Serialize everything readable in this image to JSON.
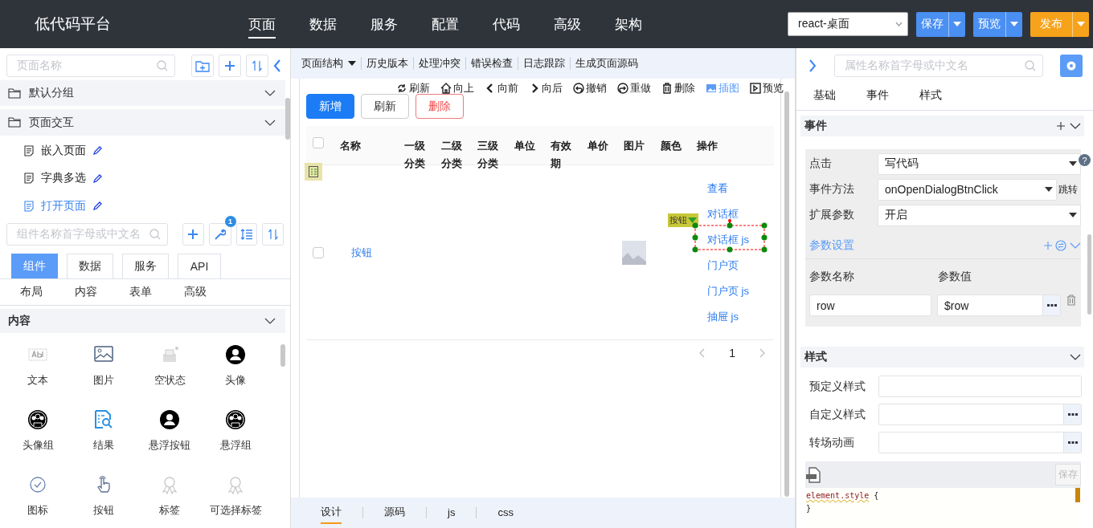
{
  "header": {
    "logo": "低代码平台",
    "nav": [
      {
        "label": "页面",
        "selected": true
      },
      {
        "label": "数据",
        "selected": false
      },
      {
        "label": "服务",
        "selected": false
      },
      {
        "label": "配置",
        "selected": false
      },
      {
        "label": "代码",
        "selected": false
      },
      {
        "label": "高级",
        "selected": false
      },
      {
        "label": "架构",
        "selected": false
      }
    ],
    "platform_select": "react-桌面",
    "actions": [
      {
        "label": "保存",
        "kind": "primary"
      },
      {
        "label": "预览",
        "kind": "primary"
      },
      {
        "label": "发布",
        "kind": "warning"
      }
    ]
  },
  "page_panel": {
    "search_placeholder": "页面名称",
    "groups": [
      {
        "label": "默认分组"
      },
      {
        "label": "页面交互",
        "children": [
          {
            "label": "嵌入页面",
            "selected": false
          },
          {
            "label": "字典多选",
            "selected": false
          },
          {
            "label": "打开页面",
            "selected": true
          }
        ]
      }
    ]
  },
  "component_panel": {
    "search_placeholder": "组件名称首字母或中文名",
    "badge": "1",
    "tabs": [
      {
        "label": "组件",
        "selected": true
      },
      {
        "label": "数据",
        "selected": false
      },
      {
        "label": "服务",
        "selected": false
      },
      {
        "label": "API",
        "selected": false
      }
    ],
    "categories": [
      "布局",
      "内容",
      "表单",
      "高级"
    ],
    "section": "内容",
    "components": [
      {
        "label": "文本",
        "kind": "text"
      },
      {
        "label": "图片",
        "kind": "image"
      },
      {
        "label": "空状态",
        "kind": "empty"
      },
      {
        "label": "头像",
        "kind": "avatar"
      },
      {
        "label": "头像组",
        "kind": "avatar-group"
      },
      {
        "label": "结果",
        "kind": "result"
      },
      {
        "label": "悬浮按钮",
        "kind": "avatar"
      },
      {
        "label": "悬浮组",
        "kind": "avatar-group"
      },
      {
        "label": "图标",
        "kind": "check"
      },
      {
        "label": "按钮",
        "kind": "pointer"
      },
      {
        "label": "标签",
        "kind": "ribbon"
      },
      {
        "label": "可选择标签",
        "kind": "ribbon"
      }
    ]
  },
  "editor": {
    "menu": [
      {
        "label": "页面结构",
        "kind": "dropdown"
      },
      {
        "label": "历史版本",
        "kind": "link"
      },
      {
        "label": "处理冲突",
        "kind": "link"
      },
      {
        "label": "错误检查",
        "kind": "link"
      },
      {
        "label": "日志跟踪",
        "kind": "link"
      },
      {
        "label": "生成页面源码",
        "kind": "link"
      }
    ],
    "canvas_actions": [
      {
        "label": "刷新",
        "kind": "refresh",
        "active": false
      },
      {
        "label": "向上",
        "kind": "home",
        "active": false
      },
      {
        "label": "向前",
        "kind": "left",
        "active": false
      },
      {
        "label": "向后",
        "kind": "right",
        "active": false
      },
      {
        "label": "撤销",
        "kind": "undo",
        "active": false
      },
      {
        "label": "重做",
        "kind": "redo",
        "active": false
      },
      {
        "label": "删除",
        "kind": "trash",
        "active": false
      },
      {
        "label": "插图",
        "kind": "image",
        "active": true
      },
      {
        "label": "预览",
        "kind": "play",
        "active": false
      }
    ],
    "buttons": [
      {
        "label": "新增",
        "kind": "primary"
      },
      {
        "label": "刷新",
        "kind": "default"
      },
      {
        "label": "删除",
        "kind": "danger"
      }
    ],
    "table": {
      "all_checked": false,
      "columns": [
        "名称",
        "一级分类",
        "二级分类",
        "三级分类",
        "单位",
        "有效期",
        "单价",
        "图片",
        "颜色",
        "操作"
      ],
      "rows": [
        {
          "checked": false,
          "name": "按钮",
          "actions": [
            {
              "label": "查看",
              "selected": false
            },
            {
              "label": "对话框",
              "selected": false
            },
            {
              "label": "对话框 js",
              "selected": true
            },
            {
              "label": "门户页",
              "selected": false
            },
            {
              "label": "门户页 js",
              "selected": false
            },
            {
              "label": "抽屉 js",
              "selected": false
            }
          ]
        }
      ]
    },
    "selection_tag": "按钮",
    "page_number": "1",
    "bottom_tabs": [
      {
        "label": "设计",
        "selected": true
      },
      {
        "label": "源码",
        "selected": false
      },
      {
        "label": "js",
        "selected": false
      },
      {
        "label": "css",
        "selected": false
      }
    ]
  },
  "props_panel": {
    "search_placeholder": "属性名称首字母或中文名",
    "tabs": [
      "基础",
      "事件",
      "样式"
    ],
    "events": {
      "title": "事件",
      "help": "?",
      "rows": [
        {
          "label": "点击",
          "value": "写代码",
          "kind": "select"
        },
        {
          "label": "事件方法",
          "value": "onOpenDialogBtnClick",
          "kind": "jump",
          "jump": "跳转"
        },
        {
          "label": "扩展参数",
          "value": "开启",
          "kind": "select"
        }
      ],
      "params": {
        "title": "参数设置",
        "columns": [
          "参数名称",
          "参数值"
        ],
        "rows": [
          {
            "name": "row",
            "value": "$row"
          }
        ]
      }
    },
    "styles": {
      "title": "样式",
      "fields": [
        {
          "label": "预定义样式",
          "kind": "plain"
        },
        {
          "label": "自定义样式",
          "kind": "more"
        },
        {
          "label": "转场动画",
          "kind": "more"
        }
      ],
      "save": "保存",
      "save_disabled": true,
      "code": [
        [
          {
            "text": "element.style",
            "kind": "selector"
          },
          {
            "text": " {",
            "kind": "punct"
          }
        ],
        [
          {
            "text": "}",
            "kind": "punct"
          }
        ]
      ]
    }
  }
}
